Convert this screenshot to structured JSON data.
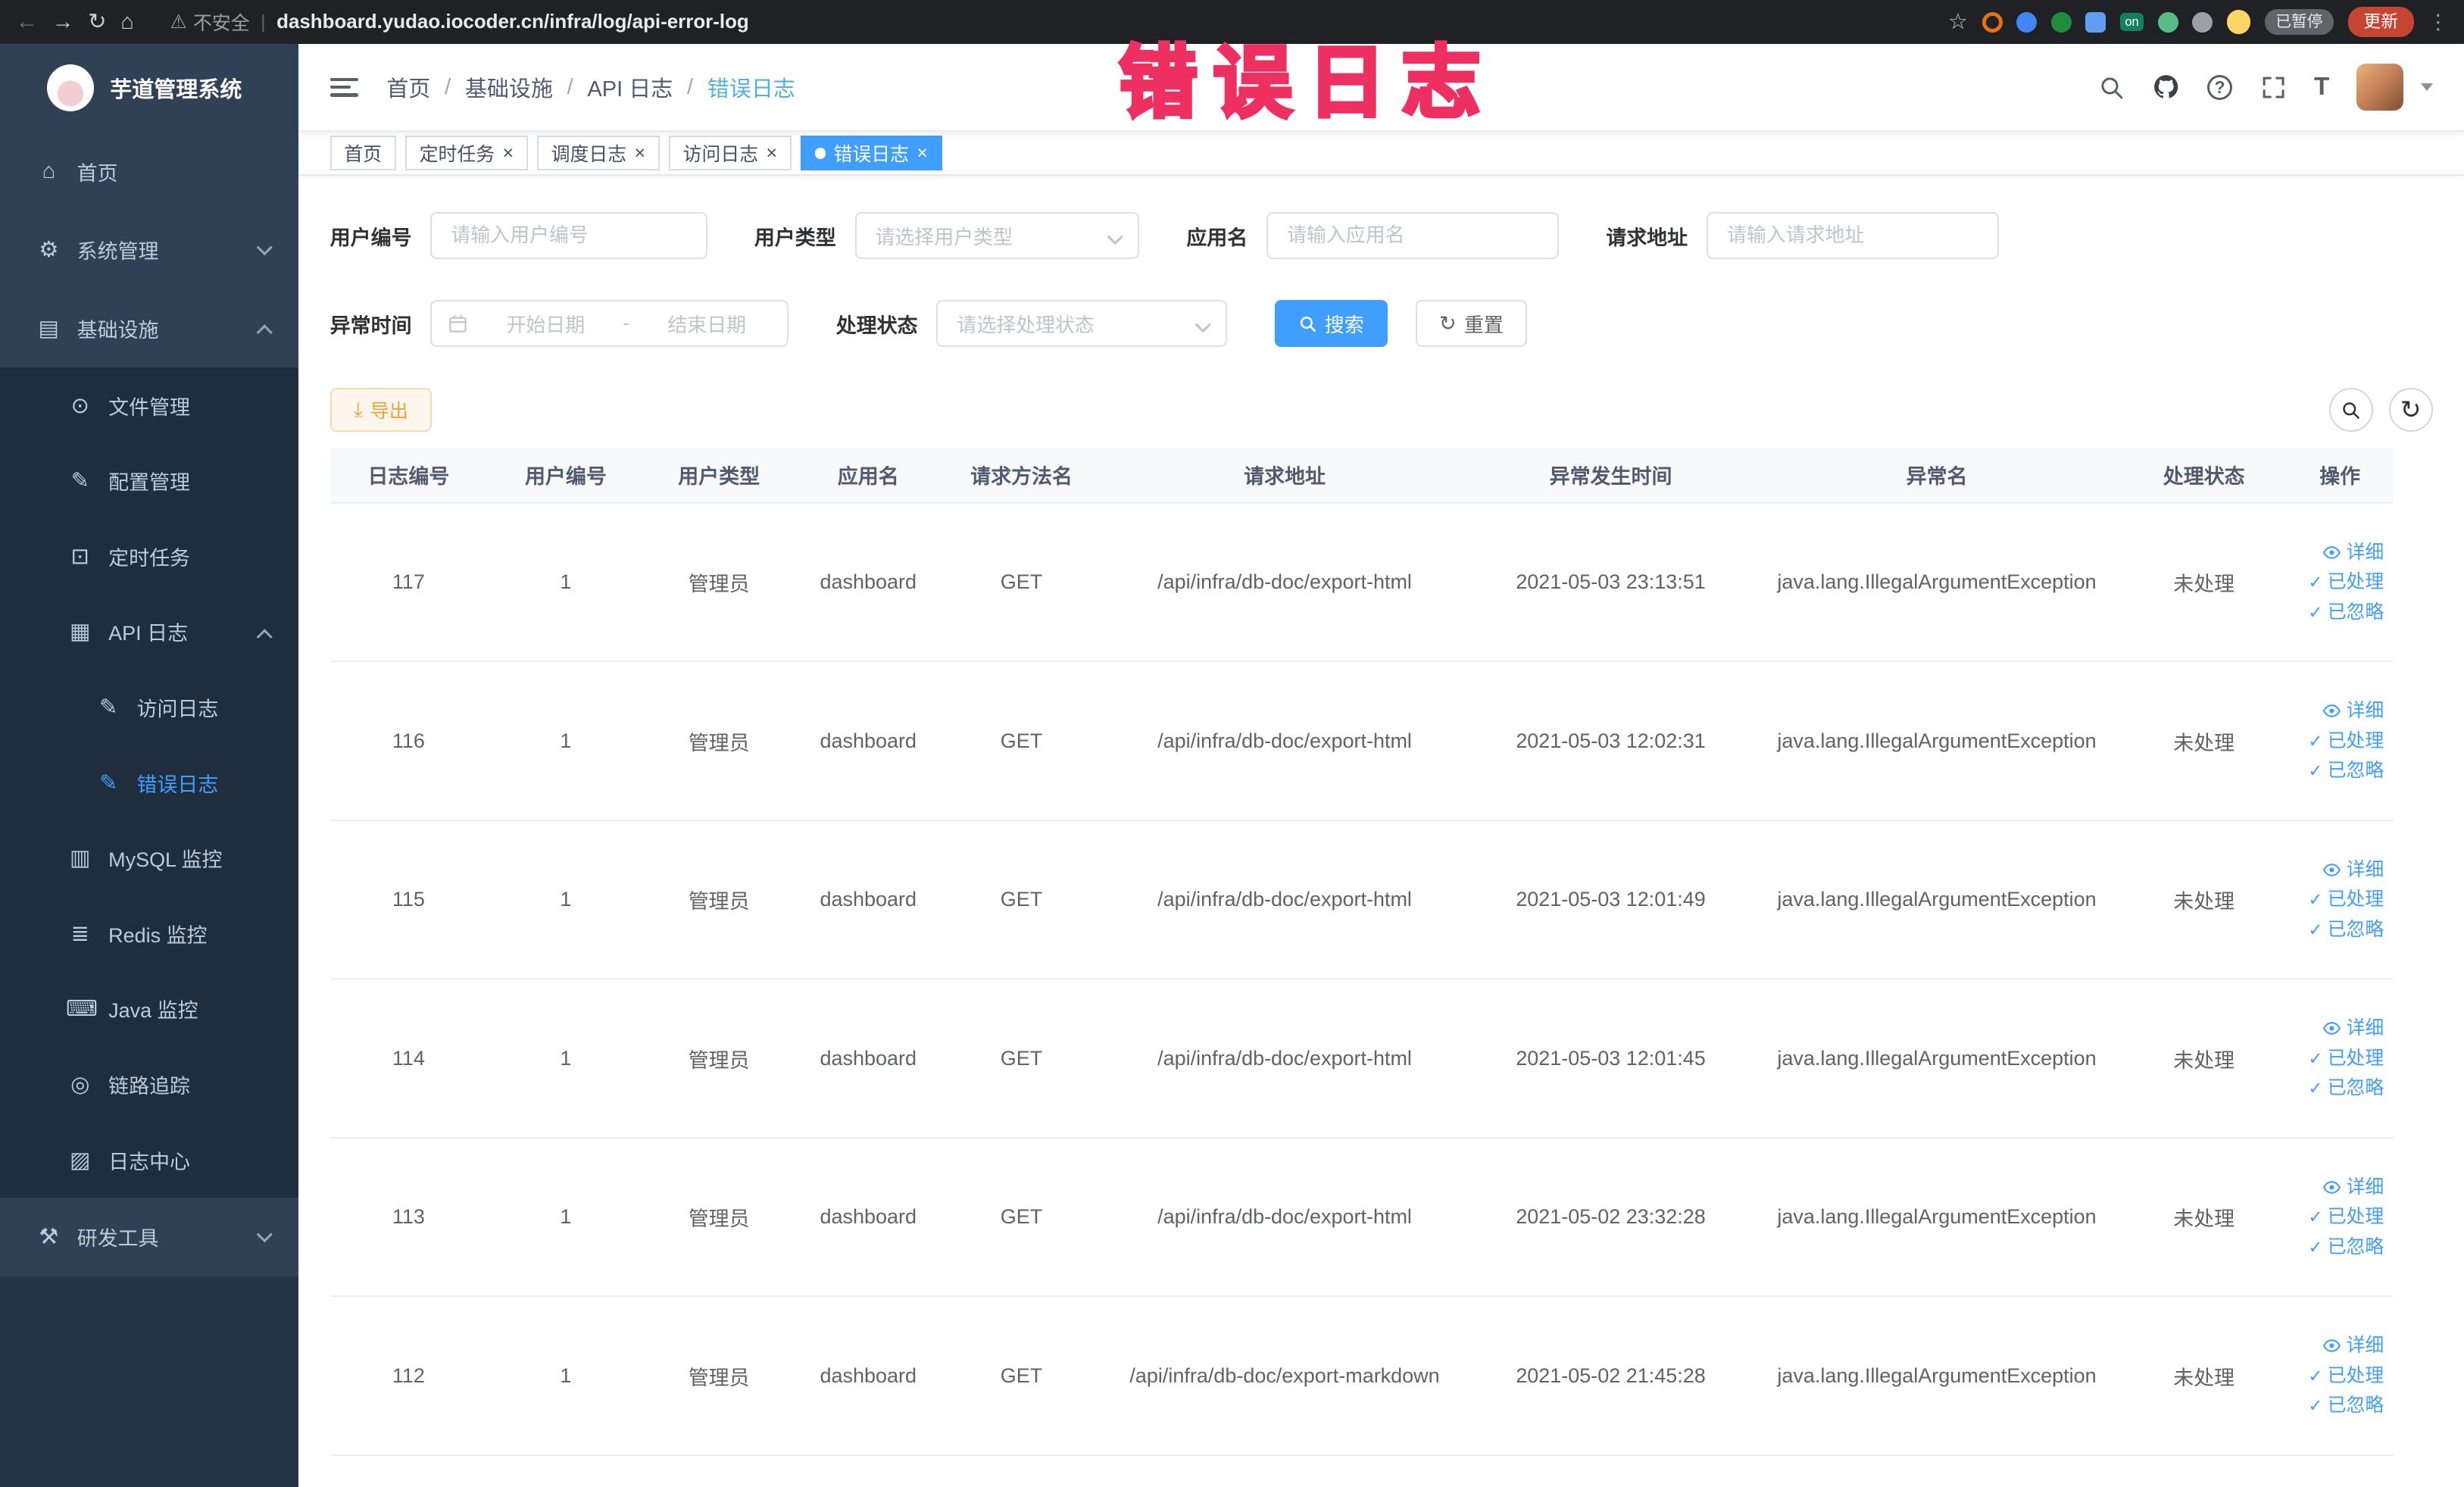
{
  "colors": {
    "primary": "#409eff",
    "warning": "#e6a23c",
    "sidebar_bg": "#304156",
    "sidebar_submenu_bg": "#1f2d3d",
    "active_text": "#409eff",
    "annotation_pink": "#ee2f62",
    "update_button_red": "#c54432"
  },
  "annotation": {
    "text": "错误日志"
  },
  "browser": {
    "security_label": "不安全",
    "url": "dashboard.yudao.iocoder.cn/infra/log/api-error-log",
    "paused_badge": "已暂停",
    "update_label": "更新",
    "icons": {
      "back": "←",
      "forward": "→",
      "reload": "↻",
      "home": "⌂",
      "star": "☆",
      "warning": "⚠",
      "menu": "⋮",
      "divider": "|",
      "ext_on": "on"
    }
  },
  "sidebar": {
    "logo_title": "芋道管理系统",
    "items": [
      {
        "label": "首页",
        "icon": "home",
        "glyph": "⌂"
      },
      {
        "label": "系统管理",
        "icon": "gear",
        "glyph": "⚙"
      },
      {
        "label": "基础设施",
        "icon": "infrastructure",
        "glyph": "▤"
      },
      {
        "label": "文件管理",
        "icon": "file-management",
        "glyph": "⊙"
      },
      {
        "label": "配置管理",
        "icon": "config-management",
        "glyph": "✎"
      },
      {
        "label": "定时任务",
        "icon": "scheduled-task",
        "glyph": "⊡"
      },
      {
        "label": "API 日志",
        "icon": "api-log",
        "glyph": "▦"
      },
      {
        "label": "访问日志",
        "icon": "access-log",
        "glyph": "✎"
      },
      {
        "label": "错误日志",
        "icon": "error-log",
        "glyph": "✎"
      },
      {
        "label": "MySQL 监控",
        "icon": "mysql-monitor",
        "glyph": "▥"
      },
      {
        "label": "Redis 监控",
        "icon": "redis-monitor",
        "glyph": "≣"
      },
      {
        "label": "Java 监控",
        "icon": "java-monitor",
        "glyph": "⌨"
      },
      {
        "label": "链路追踪",
        "icon": "trace",
        "glyph": "◎"
      },
      {
        "label": "日志中心",
        "icon": "log-center",
        "glyph": "▨"
      },
      {
        "label": "研发工具",
        "icon": "dev-tools",
        "glyph": "⚒"
      }
    ]
  },
  "header": {
    "breadcrumb": [
      "首页",
      "基础设施",
      "API 日志",
      "错误日志"
    ]
  },
  "tabs": [
    {
      "label": "首页"
    },
    {
      "label": "定时任务"
    },
    {
      "label": "调度日志"
    },
    {
      "label": "访问日志"
    },
    {
      "label": "错误日志"
    }
  ],
  "filters": {
    "user_id": {
      "label": "用户编号",
      "placeholder": "请输入用户编号"
    },
    "user_type": {
      "label": "用户类型",
      "placeholder": "请选择用户类型"
    },
    "app_name": {
      "label": "应用名",
      "placeholder": "请输入应用名"
    },
    "request_url": {
      "label": "请求地址",
      "placeholder": "请输入请求地址"
    },
    "exception_time": {
      "label": "异常时间",
      "start_placeholder": "开始日期",
      "end_placeholder": "结束日期"
    },
    "process_status": {
      "label": "处理状态",
      "placeholder": "请选择处理状态"
    },
    "search_label": "搜索",
    "reset_label": "重置"
  },
  "toolbar": {
    "export_label": "导出"
  },
  "table": {
    "headers": [
      "日志编号",
      "用户编号",
      "用户类型",
      "应用名",
      "请求方法名",
      "请求地址",
      "异常发生时间",
      "异常名",
      "处理状态",
      "操作"
    ],
    "actions": [
      "详细",
      "已处理",
      "已忽略"
    ],
    "rows": [
      {
        "id": "117",
        "user_id": "1",
        "user_type": "管理员",
        "app": "dashboard",
        "method": "GET",
        "url": "/api/infra/db-doc/export-html",
        "time": "2021-05-03 23:13:51",
        "exception": "java.lang.IllegalArgumentException",
        "status": "未处理"
      },
      {
        "id": "116",
        "user_id": "1",
        "user_type": "管理员",
        "app": "dashboard",
        "method": "GET",
        "url": "/api/infra/db-doc/export-html",
        "time": "2021-05-03 12:02:31",
        "exception": "java.lang.IllegalArgumentException",
        "status": "未处理"
      },
      {
        "id": "115",
        "user_id": "1",
        "user_type": "管理员",
        "app": "dashboard",
        "method": "GET",
        "url": "/api/infra/db-doc/export-html",
        "time": "2021-05-03 12:01:49",
        "exception": "java.lang.IllegalArgumentException",
        "status": "未处理"
      },
      {
        "id": "114",
        "user_id": "1",
        "user_type": "管理员",
        "app": "dashboard",
        "method": "GET",
        "url": "/api/infra/db-doc/export-html",
        "time": "2021-05-03 12:01:45",
        "exception": "java.lang.IllegalArgumentException",
        "status": "未处理"
      },
      {
        "id": "113",
        "user_id": "1",
        "user_type": "管理员",
        "app": "dashboard",
        "method": "GET",
        "url": "/api/infra/db-doc/export-html",
        "time": "2021-05-02 23:32:28",
        "exception": "java.lang.IllegalArgumentException",
        "status": "未处理"
      },
      {
        "id": "112",
        "user_id": "1",
        "user_type": "管理员",
        "app": "dashboard",
        "method": "GET",
        "url": "/api/infra/db-doc/export-markdown",
        "time": "2021-05-02 21:45:28",
        "exception": "java.lang.IllegalArgumentException",
        "status": "未处理"
      }
    ]
  },
  "ui": {
    "breadcrumb_separator": "/",
    "close_glyph": "×",
    "check_glyph": "✓",
    "question_glyph": "?",
    "fontsize_glyph": "T",
    "reset_icon_glyph": "↻",
    "refresh_icon_glyph": "↻",
    "export_icon_glyph": "⤓",
    "range_separator": "-"
  }
}
